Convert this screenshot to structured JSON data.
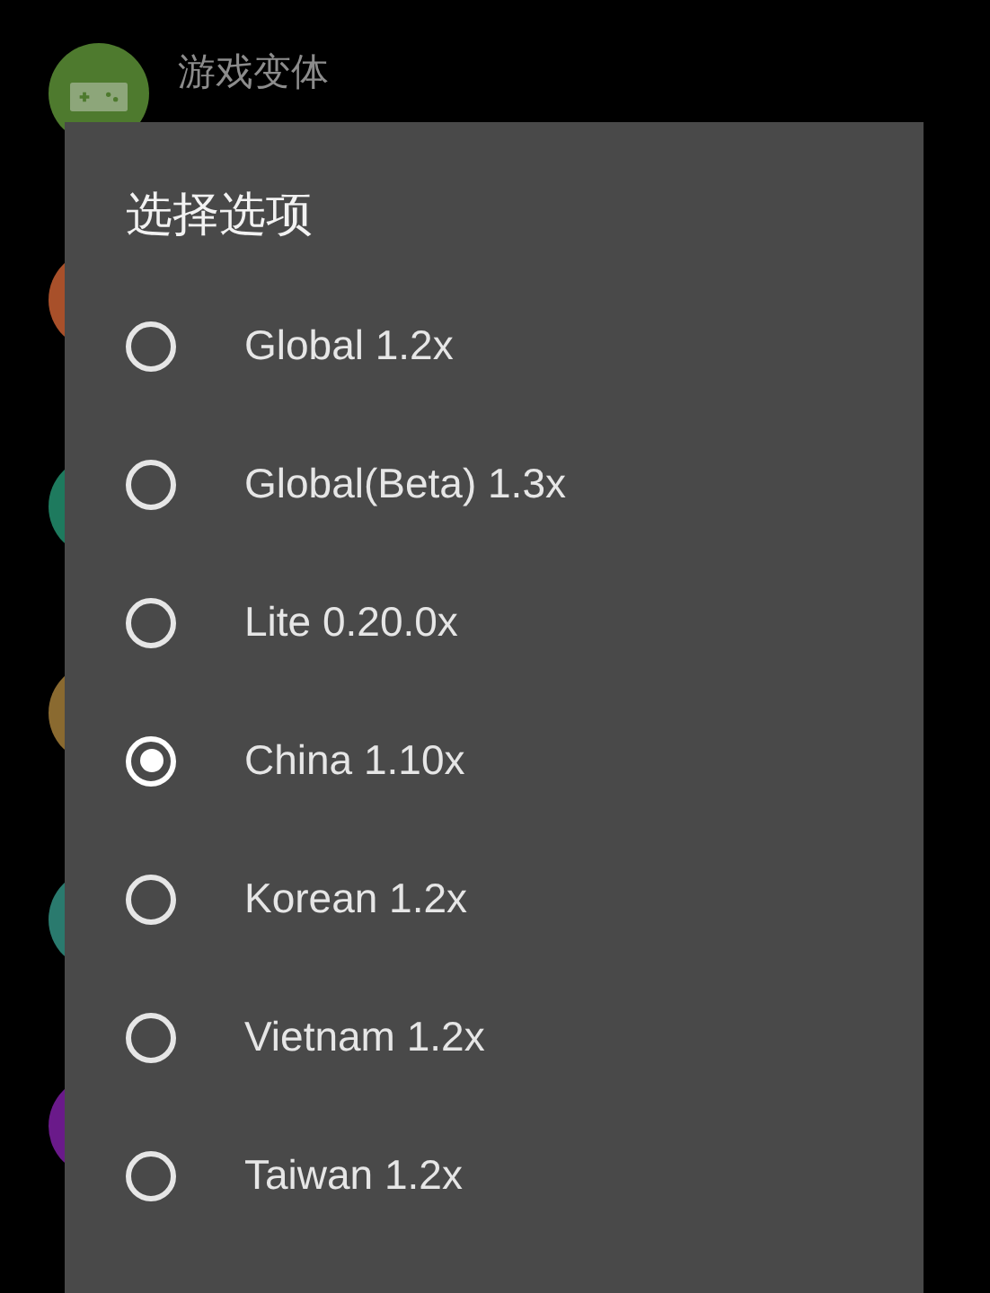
{
  "background_list": {
    "items": [
      {
        "color": "#4e7a2e",
        "title": "游戏变体",
        "kind": "gamepad"
      },
      {
        "color": "#a8502a",
        "kind": "plain"
      },
      {
        "color": "#1e7a5e",
        "kind": "plain"
      },
      {
        "color": "#8a6a30",
        "kind": "plain"
      },
      {
        "color": "#2a7a6e",
        "kind": "plain"
      },
      {
        "color": "#6a1a8a",
        "kind": "plain"
      }
    ]
  },
  "dialog": {
    "title": "选择选项",
    "options": [
      {
        "label": "Global 1.2x",
        "selected": false
      },
      {
        "label": "Global(Beta) 1.3x",
        "selected": false
      },
      {
        "label": "Lite 0.20.0x",
        "selected": false
      },
      {
        "label": "China 1.10x",
        "selected": true
      },
      {
        "label": "Korean 1.2x",
        "selected": false
      },
      {
        "label": "Vietnam 1.2x",
        "selected": false
      },
      {
        "label": "Taiwan 1.2x",
        "selected": false
      }
    ]
  }
}
